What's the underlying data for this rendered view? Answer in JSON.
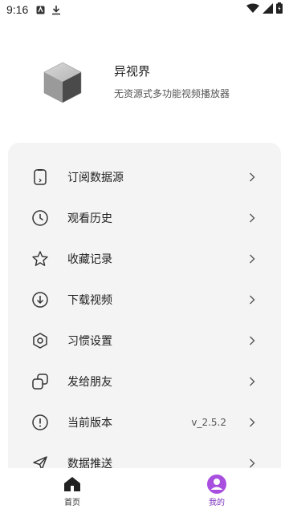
{
  "status_bar": {
    "time": "9:16"
  },
  "profile": {
    "app_name": "异视界",
    "app_desc": "无资源式多功能视频播放器"
  },
  "menu": {
    "items": [
      {
        "label": "订阅数据源",
        "value": "",
        "icon": "subscription-icon"
      },
      {
        "label": "观看历史",
        "value": "",
        "icon": "clock-icon"
      },
      {
        "label": "收藏记录",
        "value": "",
        "icon": "star-icon"
      },
      {
        "label": "下载视频",
        "value": "",
        "icon": "download-icon"
      },
      {
        "label": "习惯设置",
        "value": "",
        "icon": "settings-icon"
      },
      {
        "label": "发给朋友",
        "value": "",
        "icon": "share-icon"
      },
      {
        "label": "当前版本",
        "value": "v_2.5.2",
        "icon": "info-icon"
      },
      {
        "label": "数据推送",
        "value": "",
        "icon": "send-icon"
      }
    ]
  },
  "bottom_nav": {
    "home_label": "首页",
    "mine_label": "我的"
  },
  "colors": {
    "accent": "#a94fe0",
    "card_bg": "#f4f4f4"
  }
}
